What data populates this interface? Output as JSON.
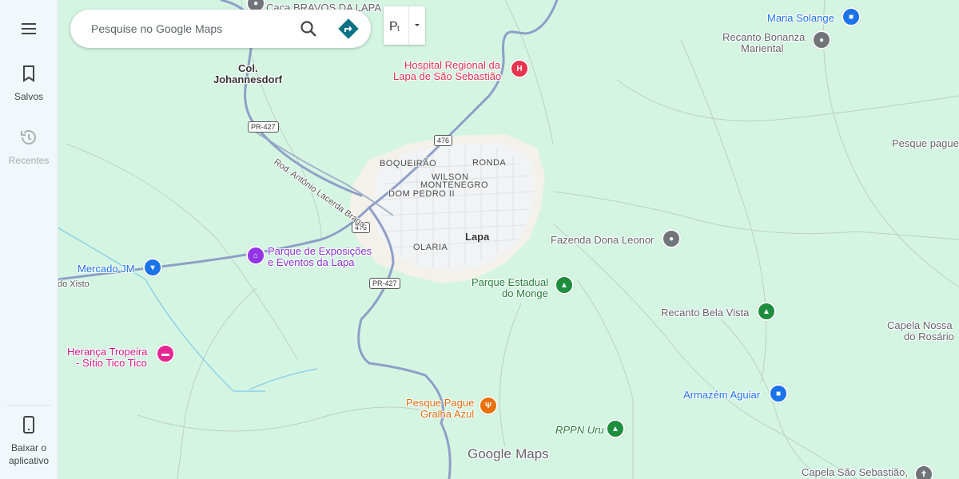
{
  "sidebar": {
    "menu_icon": "hamburger-menu-icon",
    "saved_label": "Salvos",
    "recent_label": "Recentes",
    "download_label": "Baixar o aplicativo"
  },
  "search": {
    "placeholder": "Pesquise no Google Maps",
    "search_icon": "search-icon",
    "directions_icon": "directions-icon"
  },
  "layers": {
    "icon": "transit-layer-icon",
    "dropdown_icon": "caret-down-icon"
  },
  "branding": {
    "google": "Google",
    "maps": "Maps"
  },
  "places": {
    "caca_bravos": "Caca BRAVOS DA LAPA",
    "col_joh_1": "Col.",
    "col_joh_2": "Johannesdorf",
    "hospital_1": "Hospital Regional da",
    "hospital_2": "Lapa de São Sebastião",
    "maria_solange": "Maria Solange",
    "recanto_bonanza_1": "Recanto Bonanza",
    "recanto_bonanza_2": "Mariental",
    "pesque_pague_right": "Pesque pague",
    "fazenda": "Fazenda Dona Leonor",
    "parque_estadual_1": "Parque Estadual",
    "parque_estadual_2": "do Monge",
    "recanto_bela_vista": "Recanto Bela Vista",
    "capela_rosario_1": "Capela Nossa",
    "capela_rosario_2": "do Rosário",
    "armazem": "Armazém Aguiar",
    "rppn": "RPPN Uru",
    "capela_sao_seb": "Capela São Sebastião,",
    "pesque_gralha_1": "Pesque Pague",
    "pesque_gralha_2": "Gralha Azul",
    "heranca_1": "Herança Tropeira",
    "heranca_2": "- Sítio Tico Tico",
    "mercado": "Mercado JM",
    "parque_expo_1": "Parque de Exposições",
    "parque_expo_2": "e Eventos da Lapa",
    "road_xisto": "do Xisto",
    "road_antonio": "Rod. Antônio Lacerda Braga",
    "lapa": "Lapa",
    "boqueirao": "BOQUEIRÃO",
    "ronda": "RONDA",
    "wilson_1": "WILSON",
    "wilson_2": "MONTENEGRO",
    "dom_pedro": "DOM PEDRO II",
    "olaria": "OLARIA"
  },
  "route_shields": {
    "pr427_north": "PR-427",
    "br476_north": "476",
    "br476_west": "476",
    "pr427_south": "PR-427"
  },
  "colors": {
    "land": "#d5f5e3",
    "urban": "#f1f3f4",
    "highway": "#8e9fc7",
    "hospital": "#e8344e",
    "shopping": "#1a73e8",
    "park": "#1e8e3e",
    "food": "#e8710a",
    "lodging": "#e52592",
    "event": "#9334e6",
    "generic": "#70757a"
  }
}
